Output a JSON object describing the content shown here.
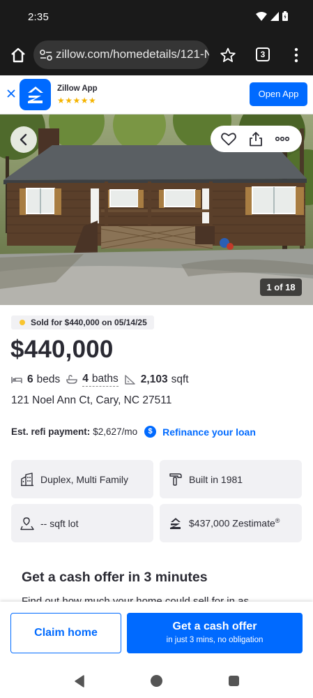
{
  "status_bar": {
    "time": "2:35"
  },
  "browser": {
    "url": "zillow.com/homedetails/121-N",
    "tab_count": "3"
  },
  "app_banner": {
    "name": "Zillow App",
    "stars": "★★★★★",
    "button": "Open App"
  },
  "hero": {
    "photo_counter": "1 of 18"
  },
  "listing": {
    "sold_badge": "Sold for $440,000 on 05/14/25",
    "price": "$440,000",
    "beds_count": "6",
    "beds_label": "beds",
    "baths_count": "4",
    "baths_label": "baths",
    "sqft_count": "2,103",
    "sqft_label": "sqft",
    "address": "121 Noel Ann Ct, Cary, NC 27511"
  },
  "refi": {
    "label": "Est. refi payment:",
    "value": "$2,627/mo",
    "icon": "$",
    "link": "Refinance your loan"
  },
  "tiles": {
    "type": "Duplex, Multi Family",
    "built": "Built in 1981",
    "lot": "-- sqft lot",
    "zestimate": "$437,000 Zestimate",
    "zestimate_mark": "®"
  },
  "cash_offer": {
    "heading": "Get a cash offer in 3 minutes",
    "subtext": "Find out how much your home could sell for in as"
  },
  "cta": {
    "claim": "Claim home",
    "cash_title": "Get a cash offer",
    "cash_sub": "in just 3 mins, no obligation"
  },
  "colors": {
    "brand": "#006aff",
    "text": "#2a2a33",
    "sold_dot": "#f9c52f",
    "tile_bg": "#f1f1f4"
  }
}
